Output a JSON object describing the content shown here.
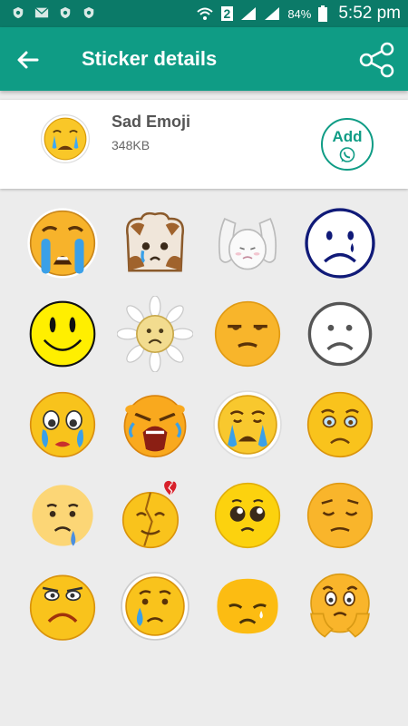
{
  "status_bar": {
    "battery": "84%",
    "time": "5:52 pm",
    "sim_slot": "2"
  },
  "app_bar": {
    "title": "Sticker details"
  },
  "pack": {
    "name": "Sad Emoji",
    "size": "348KB",
    "add_label": "Add"
  },
  "colors": {
    "toolbar": "#0f9c85",
    "status_bar": "#0b7a68",
    "accent": "#0f9c85"
  },
  "stickers": [
    {
      "icon": "loudly-crying-face-icon"
    },
    {
      "icon": "sad-toast-character-icon"
    },
    {
      "icon": "sad-bunny-character-icon"
    },
    {
      "icon": "outline-sad-tear-face-icon"
    },
    {
      "icon": "smiley-face-icon"
    },
    {
      "icon": "sad-daisy-flower-icon"
    },
    {
      "icon": "unamused-face-icon"
    },
    {
      "icon": "frowning-outline-face-icon"
    },
    {
      "icon": "crying-face-icon"
    },
    {
      "icon": "wailing-face-icon"
    },
    {
      "icon": "disappointed-tear-face-icon"
    },
    {
      "icon": "teary-worried-face-icon"
    },
    {
      "icon": "sad-sweat-drop-face-icon"
    },
    {
      "icon": "broken-heart-cracked-face-icon"
    },
    {
      "icon": "pleading-face-icon"
    },
    {
      "icon": "pensive-face-icon"
    },
    {
      "icon": "angry-frown-face-icon"
    },
    {
      "icon": "sad-tear-face-icon"
    },
    {
      "icon": "sleepy-blob-face-icon"
    },
    {
      "icon": "scared-hands-face-icon"
    }
  ]
}
